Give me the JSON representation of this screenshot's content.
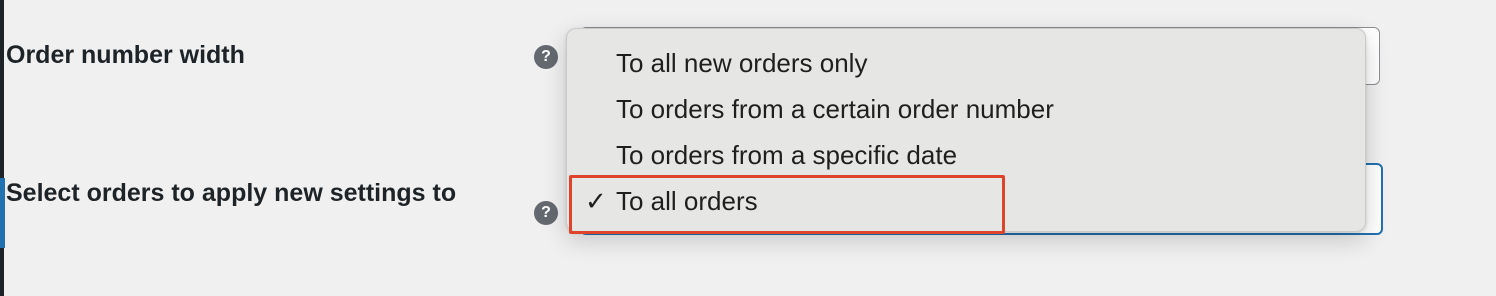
{
  "settings": {
    "order_number_width_label": "Order number width",
    "apply_settings_label": "Select orders to apply new settings to",
    "help_glyph": "?"
  },
  "dropdown": {
    "selected_index": 3,
    "check_glyph": "✓",
    "options": [
      {
        "label": "To all new orders only"
      },
      {
        "label": "To orders from a certain order number"
      },
      {
        "label": "To orders from a specific date"
      },
      {
        "label": "To all orders"
      }
    ]
  },
  "colors": {
    "focus_border": "#2271b1",
    "annotation": "#e0432b",
    "help_icon": "#646970",
    "background": "#f0f0f1"
  },
  "icons": {
    "help": "help-icon",
    "check": "checkmark-icon"
  }
}
